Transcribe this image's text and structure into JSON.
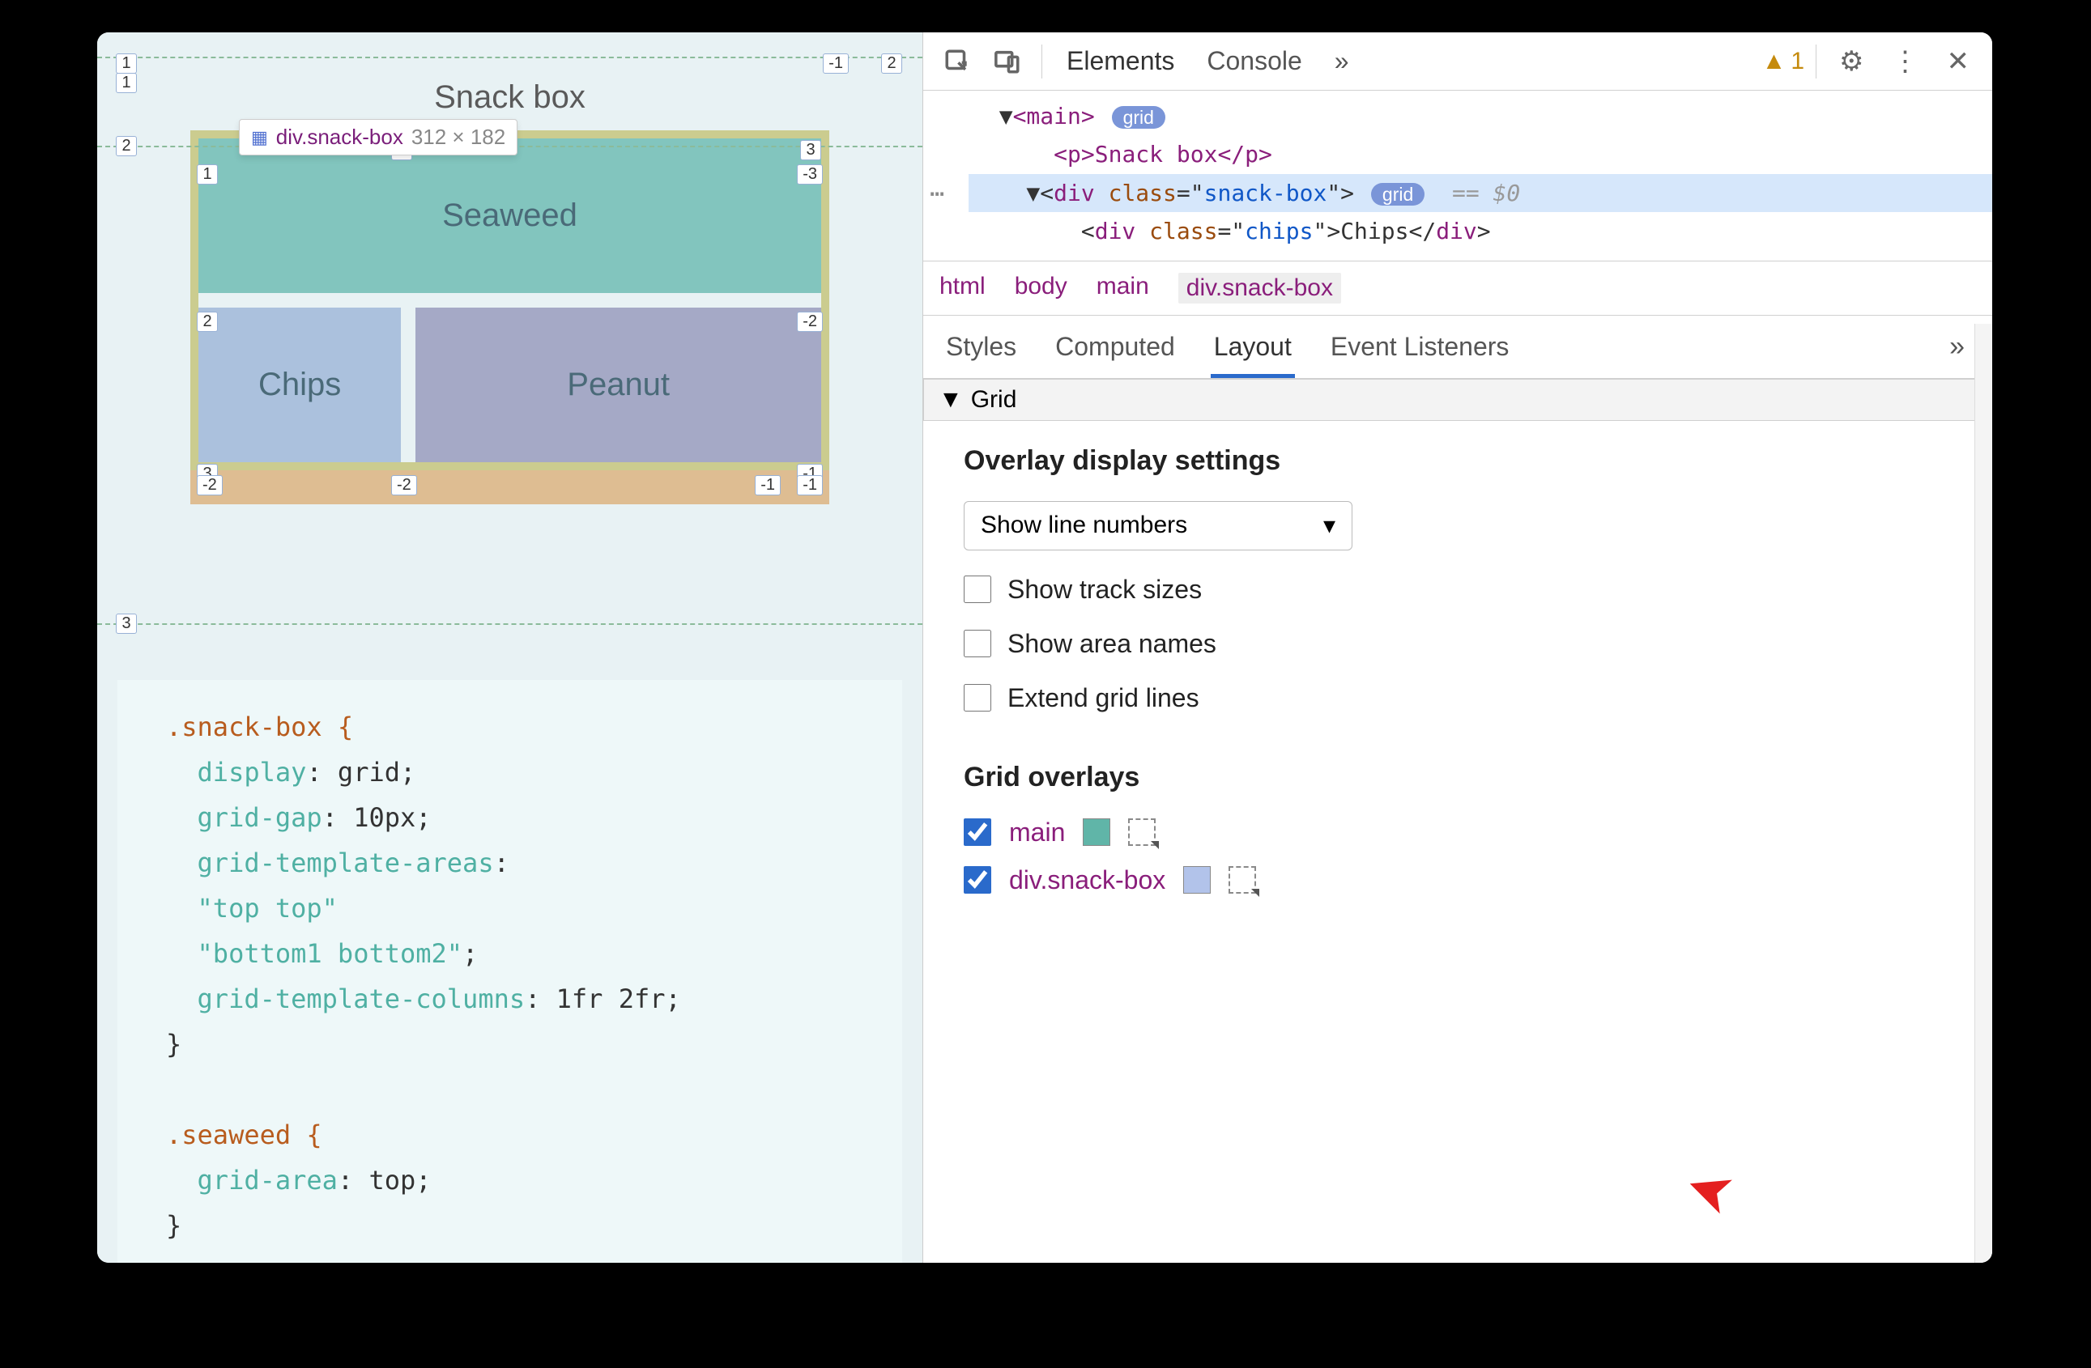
{
  "viewport": {
    "page_title": "Snack box",
    "cells": {
      "seaweed": "Seaweed",
      "chips": "Chips",
      "peanut": "Peanut"
    },
    "tooltip": {
      "selector": "div.snack-box",
      "dims": "312 × 182"
    },
    "outer_line_numbers_top": [
      "1",
      "-1",
      "2"
    ],
    "outer_line_numbers_left": [
      "1",
      "2",
      "3"
    ],
    "inner_top_nums": [
      "1",
      "2",
      "3"
    ],
    "inner_top_nums_r": [
      "-3"
    ],
    "inner_left_mid": [
      "2",
      "-2"
    ],
    "inner_bottom_nums_l": [
      "3"
    ],
    "inner_bottom_nums_r": [
      "-1"
    ],
    "strip_nums": [
      "-2",
      "-2",
      "-1",
      "-1"
    ]
  },
  "code": {
    "line1": ".snack-box {",
    "line2_prop": "display",
    "line2_val": "grid",
    "line3_prop": "grid-gap",
    "line3_val": "10px",
    "line4_prop": "grid-template-areas",
    "line5_val": "\"top top\"",
    "line6_val": "\"bottom1 bottom2\"",
    "line7_prop": "grid-template-columns",
    "line7_val": "1fr 2fr",
    "line8": "}",
    "line10": ".seaweed {",
    "line11_prop": "grid-area",
    "line11_val": "top",
    "line12": "}"
  },
  "devtools": {
    "tabs": {
      "elements": "Elements",
      "console": "Console",
      "more": "»"
    },
    "warning_count": "1",
    "dom": {
      "main_open": "<main>",
      "grid_badge": "grid",
      "p_line": "<p>Snack box</p>",
      "div_open_tag": "div",
      "div_class_attr": "class",
      "div_class_val": "snack-box",
      "eq_dollar": "== $0",
      "chips_tag": "div",
      "chips_class_attr": "class",
      "chips_class_val": "chips",
      "chips_text": "Chips"
    },
    "breadcrumb": [
      "html",
      "body",
      "main",
      "div.snack-box"
    ],
    "subtabs": {
      "styles": "Styles",
      "computed": "Computed",
      "layout": "Layout",
      "listeners": "Event Listeners",
      "more": "»"
    },
    "section_grid": "Grid",
    "overlay_settings_heading": "Overlay display settings",
    "select_label": "Show line numbers",
    "checks": {
      "track_sizes": "Show track sizes",
      "area_names": "Show area names",
      "extend_lines": "Extend grid lines"
    },
    "grid_overlays_heading": "Grid overlays",
    "overlays": {
      "main": {
        "label": "main",
        "color": "#60b5a8"
      },
      "snackbox": {
        "label": "div.snack-box",
        "color": "#b2c3ea"
      }
    }
  }
}
